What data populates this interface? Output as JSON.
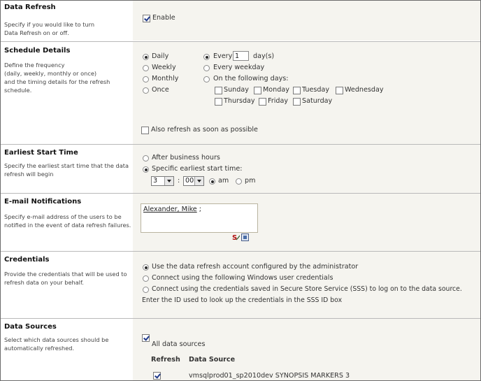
{
  "data_refresh": {
    "title": "Data Refresh",
    "desc": [
      "Specify if you would like to turn",
      "Data Refresh on or off."
    ],
    "enable_label": "Enable",
    "enabled": true
  },
  "schedule": {
    "title": "Schedule Details",
    "desc": [
      "Define the frequency",
      "(daily, weekly, monthly or once)",
      "and the timing details for the refresh",
      "schedule."
    ],
    "frequency": [
      "Daily",
      "Weekly",
      "Monthly",
      "Once"
    ],
    "frequency_selected": "Daily",
    "every_label": "Every",
    "every_value": "1",
    "days_suffix": "day(s)",
    "every_weekday": "Every weekday",
    "following_days": "On the following days:",
    "days_row1": [
      "Sunday",
      "Monday",
      "Tuesday",
      "Wednesday"
    ],
    "days_row2": [
      "Thursday",
      "Friday",
      "Saturday"
    ],
    "also_refresh": "Also refresh as soon as possible"
  },
  "start_time": {
    "title": "Earliest Start Time",
    "desc": [
      "Specify the earliest start time that the data",
      "refresh will begin"
    ],
    "after_hours": "After business hours",
    "specific": "Specific earliest start time:",
    "hour": "3",
    "colon": ":",
    "minute": "00",
    "am": "am",
    "pm": "pm"
  },
  "email": {
    "title": "E-mail Notifications",
    "desc": [
      "Specify e-mail address of the users to be",
      "notified in the event of data refresh failures."
    ],
    "person": "Alexander, Mike",
    "separator": ";"
  },
  "credentials": {
    "title": "Credentials",
    "desc": [
      "Provide the credentials that will be used to",
      "refresh data on your behalf."
    ],
    "options": [
      "Use the data refresh account configured by the administrator",
      "Connect using the following Windows user credentials",
      "Connect using the credentials saved in Secure Store Service (SSS) to log on to the data source."
    ],
    "sss_note": "Enter the ID used to look up the credentials in the SSS ID box"
  },
  "data_sources": {
    "title": "Data Sources",
    "desc": [
      "Select which data sources should be",
      "automatically refreshed."
    ],
    "all_label": "All data sources",
    "col_refresh": "Refresh",
    "col_source": "Data Source",
    "rows": [
      {
        "name": "vmsqlprod01_sp2010dev SYNOPSIS MARKERS 3"
      }
    ]
  },
  "colors": {
    "panel": "#f5f4ef",
    "border": "#b9b9b9",
    "check": "#203a8a"
  }
}
